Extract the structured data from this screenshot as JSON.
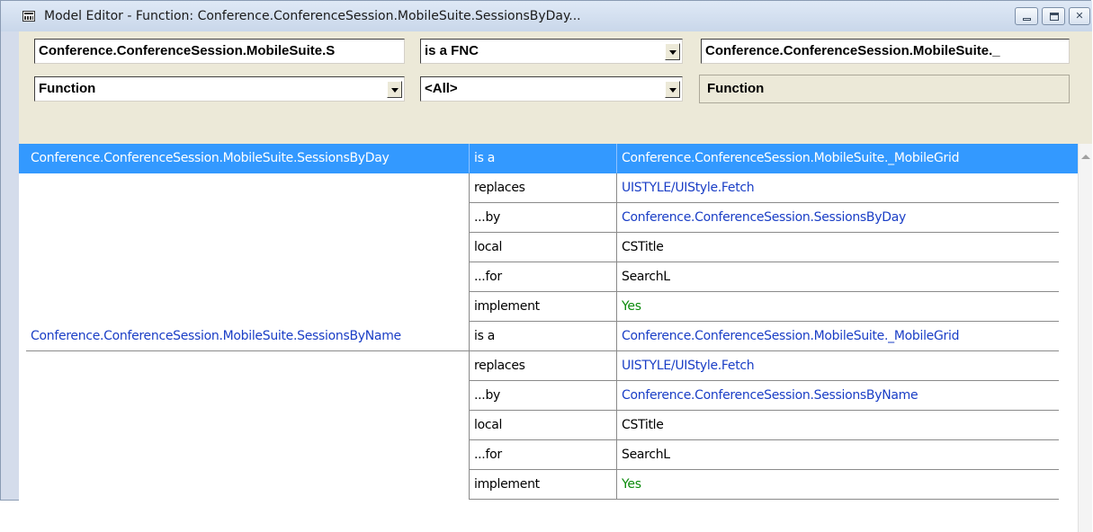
{
  "window": {
    "title": "Model Editor - Function: Conference.ConferenceSession.MobileSuite.SessionsByDay..."
  },
  "toolbar": {
    "subject_value": "Conference.ConferenceSession.MobileSuite.S",
    "verb_value": "is a FNC",
    "object_value": "Conference.ConferenceSession.MobileSuite._",
    "type_filter_value": "Function",
    "verb_filter_value": "<All>",
    "object_type_label": "Function"
  },
  "grid": {
    "rows": [
      {
        "object": "Conference.ConferenceSession.MobileSuite.SessionsByDay",
        "verb": "is a",
        "value": "Conference.ConferenceSession.MobileSuite._MobileGrid",
        "value_style": "link",
        "selected": true
      },
      {
        "object": "",
        "verb": "replaces",
        "value": "UISTYLE/UIStyle.Fetch",
        "value_style": "link"
      },
      {
        "object": "",
        "verb": "...by",
        "value": "Conference.ConferenceSession.SessionsByDay",
        "value_style": "link"
      },
      {
        "object": "",
        "verb": "local",
        "value": "CSTitle",
        "value_style": "plain"
      },
      {
        "object": "",
        "verb": "...for",
        "value": "SearchL",
        "value_style": "plain"
      },
      {
        "object": "",
        "verb": "implement",
        "value": "Yes",
        "value_style": "green"
      },
      {
        "object": "Conference.ConferenceSession.MobileSuite.SessionsByName",
        "verb": "is a",
        "value": "Conference.ConferenceSession.MobileSuite._MobileGrid",
        "value_style": "link"
      },
      {
        "object": "",
        "verb": "replaces",
        "value": "UISTYLE/UIStyle.Fetch",
        "value_style": "link"
      },
      {
        "object": "",
        "verb": "...by",
        "value": "Conference.ConferenceSession.SessionsByName",
        "value_style": "link"
      },
      {
        "object": "",
        "verb": "local",
        "value": "CSTitle",
        "value_style": "plain"
      },
      {
        "object": "",
        "verb": "...for",
        "value": "SearchL",
        "value_style": "plain"
      },
      {
        "object": "",
        "verb": "implement",
        "value": "Yes",
        "value_style": "green"
      }
    ]
  },
  "colors": {
    "selection": "#3399ff",
    "link": "#1a3ec6",
    "green": "#0a8a0a"
  }
}
